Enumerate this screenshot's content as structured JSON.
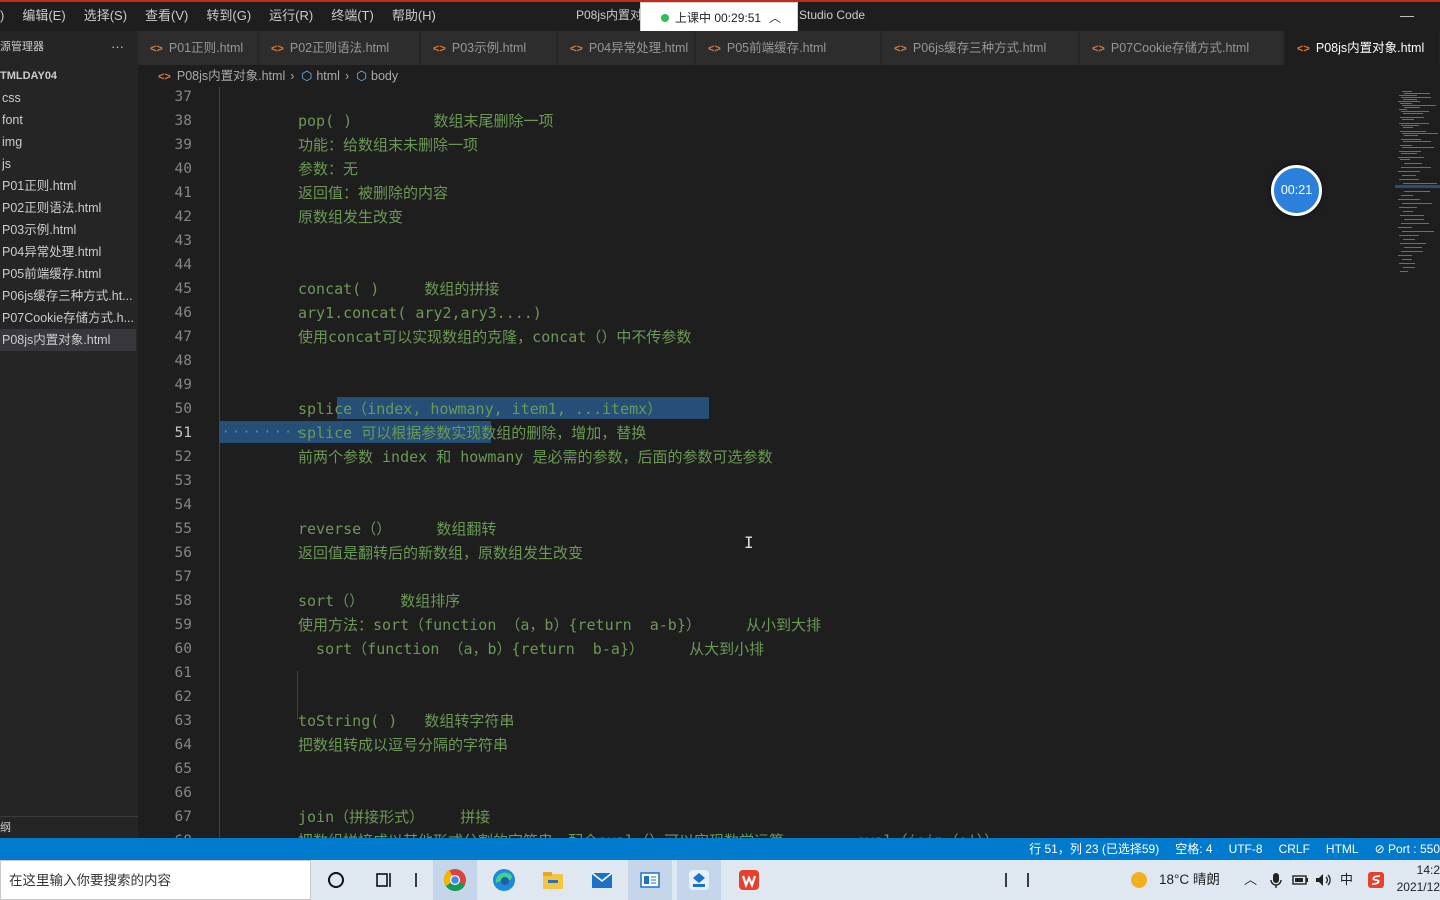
{
  "menu": [
    "编辑(E)",
    "选择(S)",
    "查看(V)",
    "转到(G)",
    "运行(R)",
    "终端(T)",
    "帮助(H)"
  ],
  "menu_prefix": ")",
  "window_title_left": "P08js内置对",
  "window_title_right": "Studio Code",
  "recording": {
    "label": "上课中 00:29:51"
  },
  "sidebar": {
    "title": "源管理器",
    "more": "···",
    "folder": "TMLDAY04",
    "items": [
      "css",
      "font",
      "img",
      "js",
      "P01正则.html",
      "P02正则语法.html",
      "P03示例.html",
      "P04异常处理.html",
      "P05前端缓存.html",
      "P06js缓存三种方式.ht...",
      "P07Cookie存储方式.h...",
      "P08js内置对象.html"
    ],
    "active_index": 11,
    "outline": "纲"
  },
  "tabs": [
    "P01正则.html",
    "P02正则语法.html",
    "P03示例.html",
    "P04异常处理.html",
    "P05前端缓存.html",
    "P06js缓存三种方式.html",
    "P07Cookie存储方式.html",
    "P08js内置对象.html"
  ],
  "tab_icon": "<>",
  "active_tab": 7,
  "breadcrumb": {
    "file": "P08js内置对象.html",
    "part1": "html",
    "part2": "body"
  },
  "editor": {
    "current_line": 51,
    "lines": [
      {
        "n": 37,
        "t": ""
      },
      {
        "n": 38,
        "t": "pop( )         数组末尾删除一项"
      },
      {
        "n": 39,
        "t": "功能：给数组末未删除一项"
      },
      {
        "n": 40,
        "t": "参数：无"
      },
      {
        "n": 41,
        "t": "返回值：被删除的内容"
      },
      {
        "n": 42,
        "t": "原数组发生改变"
      },
      {
        "n": 43,
        "t": ""
      },
      {
        "n": 44,
        "t": ""
      },
      {
        "n": 45,
        "t": "concat( )     数组的拼接"
      },
      {
        "n": 46,
        "t": "ary1.concat( ary2,ary3....)"
      },
      {
        "n": 47,
        "t": "使用concat可以实现数组的克隆，concat（）中不传参数"
      },
      {
        "n": 48,
        "t": ""
      },
      {
        "n": 49,
        "t": ""
      },
      {
        "n": 50,
        "t": "splice（index, howmany, item1, ...itemx）"
      },
      {
        "n": 51,
        "t": "splice 可以根据参数实现数组的删除，增加，替换"
      },
      {
        "n": 52,
        "t": "前两个参数 index 和 howmany 是必需的参数，后面的参数可选参数"
      },
      {
        "n": 53,
        "t": ""
      },
      {
        "n": 54,
        "t": ""
      },
      {
        "n": 55,
        "t": "reverse（）     数组翻转"
      },
      {
        "n": 56,
        "t": "返回值是翻转后的新数组，原数组发生改变"
      },
      {
        "n": 57,
        "t": ""
      },
      {
        "n": 58,
        "t": "sort（）    数组排序"
      },
      {
        "n": 59,
        "t": "使用方法：sort（function （a，b）{return  a-b}）     从小到大排"
      },
      {
        "n": 60,
        "t": "  sort（function （a，b）{return  b-a}）     从大到小排"
      },
      {
        "n": 61,
        "t": ""
      },
      {
        "n": 62,
        "t": ""
      },
      {
        "n": 63,
        "t": "toString( )   数组转字符串"
      },
      {
        "n": 64,
        "t": "把数组转成以逗号分隔的字符串"
      },
      {
        "n": 65,
        "t": ""
      },
      {
        "n": 66,
        "t": ""
      },
      {
        "n": 67,
        "t": "join（拼接形式）    拼接"
      },
      {
        "n": 68,
        "t": "把数组拼接成以其他形式分割的字符串，配合eval（）可以实现数学运算        eval（join（+|））"
      }
    ]
  },
  "timer": "00:21",
  "statusbar": [
    "行 51，列 23 (已选择59)",
    "空格: 4",
    "UTF-8",
    "CRLF",
    "HTML",
    "⊘ Port : 550"
  ],
  "taskbar": {
    "search_placeholder": "在这里输入你要搜索的内容",
    "weather": "18°C  晴朗",
    "time": "14:2",
    "date": "2021/12"
  },
  "colors": {
    "accent": "#007acc",
    "comment": "#6a9955",
    "selection": "#264f78",
    "recording_dot": "#2bc056"
  }
}
